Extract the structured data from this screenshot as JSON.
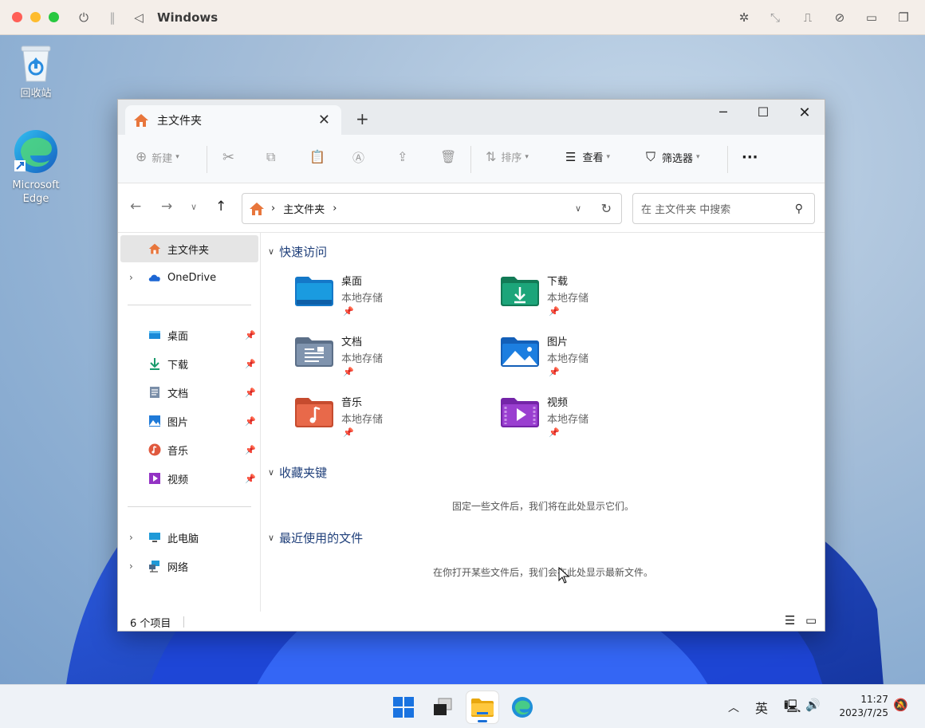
{
  "mac": {
    "title": "Windows"
  },
  "desktop": {
    "icons": [
      {
        "label": "回收站"
      },
      {
        "label_line1": "Microsoft",
        "label_line2": "Edge"
      }
    ]
  },
  "explorer": {
    "tab_title": "主文件夹",
    "tab_close": "✕",
    "new_tab": "+",
    "toolbar": {
      "new": "新建",
      "sort": "排序",
      "view": "查看",
      "filter": "筛选器",
      "more": "···"
    },
    "breadcrumb": "主文件夹",
    "search_placeholder": "在 主文件夹 中搜索",
    "sidebar": {
      "home": "主文件夹",
      "onedrive": "OneDrive",
      "pinned": [
        "桌面",
        "下载",
        "文档",
        "图片",
        "音乐",
        "视频"
      ],
      "thispc": "此电脑",
      "network": "网络"
    },
    "sections": {
      "quick": "快速访问",
      "favorites": "收藏夹键",
      "recent": "最近使用的文件"
    },
    "quick_items": [
      {
        "name": "桌面",
        "sub": "本地存储"
      },
      {
        "name": "下载",
        "sub": "本地存储"
      },
      {
        "name": "文档",
        "sub": "本地存储"
      },
      {
        "name": "图片",
        "sub": "本地存储"
      },
      {
        "name": "音乐",
        "sub": "本地存储"
      },
      {
        "name": "视频",
        "sub": "本地存储"
      }
    ],
    "favorites_empty": "固定一些文件后，我们将在此处显示它们。",
    "recent_empty": "在你打开某些文件后，我们会在此处显示最新文件。",
    "status": "6 个项目"
  },
  "taskbar": {
    "ime": "英",
    "time": "11:27",
    "date": "2023/7/25"
  }
}
